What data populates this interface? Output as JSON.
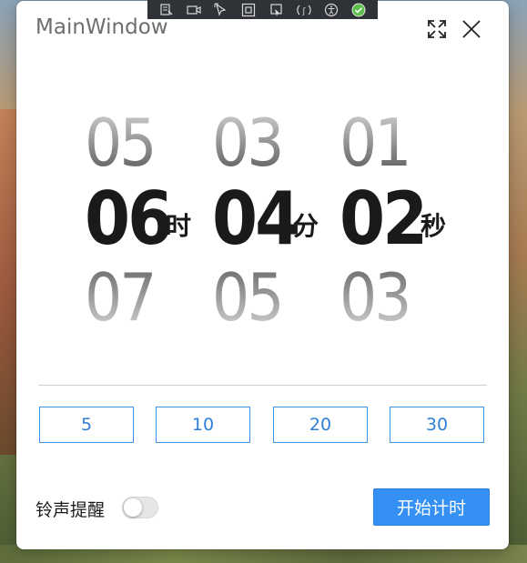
{
  "window": {
    "title": "MainWindow"
  },
  "devtools": {
    "icons": [
      "select-element-icon",
      "video-icon",
      "pointer-icon",
      "frame-icon",
      "tracking-icon",
      "hot-reload-icon",
      "accessibility-icon",
      "check-icon"
    ]
  },
  "picker": {
    "hours": {
      "prev": "05",
      "current": "06",
      "next": "07",
      "unit": "时"
    },
    "minutes": {
      "prev": "03",
      "current": "04",
      "next": "05",
      "unit": "分"
    },
    "seconds": {
      "prev": "01",
      "current": "02",
      "next": "03",
      "unit": "秒"
    }
  },
  "presets": [
    "5",
    "10",
    "20",
    "30"
  ],
  "ring": {
    "label": "铃声提醒",
    "enabled": false
  },
  "start_button": {
    "label": "开始计时"
  },
  "colors": {
    "accent": "#3590f3",
    "preset_border": "#3a8ee6"
  }
}
